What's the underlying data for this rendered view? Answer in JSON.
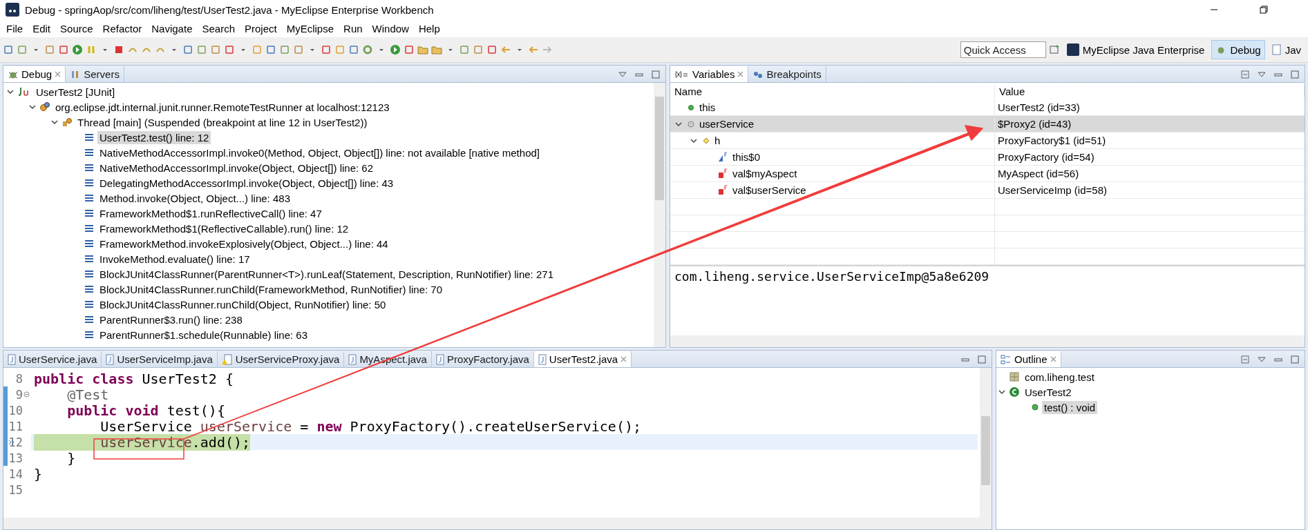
{
  "window": {
    "title": "Debug - springAop/src/com/liheng/test/UserTest2.java - MyEclipse Enterprise Workbench"
  },
  "menu": [
    "File",
    "Edit",
    "Source",
    "Refactor",
    "Navigate",
    "Search",
    "Project",
    "MyEclipse",
    "Run",
    "Window",
    "Help"
  ],
  "quick_access": {
    "placeholder": "Quick Access"
  },
  "perspectives": [
    {
      "label": "MyEclipse Java Enterprise",
      "selected": false
    },
    {
      "label": "Debug",
      "selected": true
    },
    {
      "label": "Jav",
      "selected": false
    }
  ],
  "debug": {
    "tabs": [
      {
        "label": "Debug",
        "selected": true,
        "kind": "debug"
      },
      {
        "label": "Servers",
        "selected": false,
        "kind": "servers"
      }
    ],
    "tree": [
      {
        "label": "UserTest2 [JUnit]",
        "kind": "launch",
        "expanded": true,
        "selected": false,
        "children": [
          {
            "label": "org.eclipse.jdt.internal.junit.runner.RemoteTestRunner at localhost:12123",
            "kind": "target",
            "expanded": true,
            "selected": false,
            "children": [
              {
                "label": "Thread [main] (Suspended (breakpoint at line 12 in UserTest2))",
                "kind": "thread",
                "expanded": true,
                "selected": false,
                "children": [
                  {
                    "label": "UserTest2.test() line: 12",
                    "kind": "frame",
                    "selected": true
                  },
                  {
                    "label": "NativeMethodAccessorImpl.invoke0(Method, Object, Object[]) line: not available [native method]",
                    "kind": "frame",
                    "selected": false
                  },
                  {
                    "label": "NativeMethodAccessorImpl.invoke(Object, Object[]) line: 62",
                    "kind": "frame",
                    "selected": false
                  },
                  {
                    "label": "DelegatingMethodAccessorImpl.invoke(Object, Object[]) line: 43",
                    "kind": "frame",
                    "selected": false
                  },
                  {
                    "label": "Method.invoke(Object, Object...) line: 483",
                    "kind": "frame",
                    "selected": false
                  },
                  {
                    "label": "FrameworkMethod$1.runReflectiveCall() line: 47",
                    "kind": "frame",
                    "selected": false
                  },
                  {
                    "label": "FrameworkMethod$1(ReflectiveCallable).run() line: 12",
                    "kind": "frame",
                    "selected": false
                  },
                  {
                    "label": "FrameworkMethod.invokeExplosively(Object, Object...) line: 44",
                    "kind": "frame",
                    "selected": false
                  },
                  {
                    "label": "InvokeMethod.evaluate() line: 17",
                    "kind": "frame",
                    "selected": false
                  },
                  {
                    "label": "BlockJUnit4ClassRunner(ParentRunner<T>).runLeaf(Statement, Description, RunNotifier) line: 271",
                    "kind": "frame",
                    "selected": false
                  },
                  {
                    "label": "BlockJUnit4ClassRunner.runChild(FrameworkMethod, RunNotifier) line: 70",
                    "kind": "frame",
                    "selected": false
                  },
                  {
                    "label": "BlockJUnit4ClassRunner.runChild(Object, RunNotifier) line: 50",
                    "kind": "frame",
                    "selected": false
                  },
                  {
                    "label": "ParentRunner$3.run() line: 238",
                    "kind": "frame",
                    "selected": false
                  },
                  {
                    "label": "ParentRunner$1.schedule(Runnable) line: 63",
                    "kind": "frame",
                    "selected": false
                  }
                ]
              }
            ]
          }
        ]
      }
    ]
  },
  "variables": {
    "tabs": [
      {
        "label": "Variables",
        "selected": true,
        "kind": "variables"
      },
      {
        "label": "Breakpoints",
        "selected": false,
        "kind": "breakpoints"
      }
    ],
    "columns": [
      "Name",
      "Value"
    ],
    "rows": [
      {
        "name": "this",
        "value": "UserTest2  (id=33)",
        "kind": "local",
        "selected": false
      },
      {
        "name": "userService",
        "value": "$Proxy2  (id=43)",
        "kind": "proxy",
        "selected": true,
        "expanded": true,
        "children": [
          {
            "name": "h",
            "value": "ProxyFactory$1  (id=51)",
            "kind": "field",
            "selected": false,
            "expanded": true,
            "children": [
              {
                "name": "this$0",
                "value": "ProxyFactory  (id=54)",
                "kind": "final_field",
                "selected": false
              },
              {
                "name": "val$myAspect",
                "value": "MyAspect  (id=56)",
                "kind": "private_field",
                "selected": false
              },
              {
                "name": "val$userService",
                "value": "UserServiceImp  (id=58)",
                "kind": "private_field",
                "selected": false
              }
            ]
          }
        ]
      }
    ],
    "detail": "com.liheng.service.UserServiceImp@5a8e6209"
  },
  "editor": {
    "tabs": [
      {
        "label": "UserService.java",
        "selected": false,
        "kind": "java"
      },
      {
        "label": "UserServiceImp.java",
        "selected": false,
        "kind": "java"
      },
      {
        "label": "UserServiceProxy.java",
        "selected": false,
        "kind": "java_warning"
      },
      {
        "label": "MyAspect.java",
        "selected": false,
        "kind": "java"
      },
      {
        "label": "ProxyFactory.java",
        "selected": false,
        "kind": "java"
      },
      {
        "label": "UserTest2.java",
        "selected": true,
        "kind": "java"
      }
    ],
    "lines": [
      {
        "number": "8",
        "range": false,
        "foldable": false,
        "current": false,
        "tokens": [
          {
            "text": "public class",
            "kind": "keyword"
          },
          {
            "text": " UserTest2 {",
            "kind": "plain"
          }
        ]
      },
      {
        "number": "9",
        "range": true,
        "foldable": true,
        "current": false,
        "tokens": [
          {
            "text": "    @Test",
            "kind": "annotation"
          }
        ]
      },
      {
        "number": "10",
        "range": true,
        "foldable": false,
        "current": false,
        "tokens": [
          {
            "text": "    public void",
            "kind": "keyword"
          },
          {
            "text": " test(){",
            "kind": "plain"
          }
        ]
      },
      {
        "number": "11",
        "range": true,
        "foldable": false,
        "current": false,
        "tokens": [
          {
            "text": "        UserService ",
            "kind": "plain"
          },
          {
            "text": "userService",
            "kind": "local"
          },
          {
            "text": " = ",
            "kind": "plain"
          },
          {
            "text": "new",
            "kind": "keyword"
          },
          {
            "text": " ProxyFactory().createUserService();",
            "kind": "plain"
          }
        ]
      },
      {
        "number": "12",
        "range": true,
        "foldable": false,
        "current": true,
        "tokens": [
          {
            "text": "        userService",
            "kind": "local"
          },
          {
            "text": ".add();",
            "kind": "plain"
          }
        ]
      },
      {
        "number": "13",
        "range": true,
        "foldable": false,
        "current": false,
        "tokens": [
          {
            "text": "    }",
            "kind": "plain"
          }
        ]
      },
      {
        "number": "14",
        "range": false,
        "foldable": false,
        "current": false,
        "tokens": [
          {
            "text": "}",
            "kind": "plain"
          }
        ]
      },
      {
        "number": "15",
        "range": false,
        "foldable": false,
        "current": false
      }
    ]
  },
  "outline": {
    "tabs": [
      {
        "label": "Outline",
        "selected": true,
        "kind": "outline"
      }
    ],
    "tree": [
      {
        "label": "com.liheng.test",
        "kind": "package",
        "selected": false
      },
      {
        "label": "UserTest2",
        "kind": "class",
        "selected": false,
        "expanded": true,
        "children": [
          {
            "label": "test() : void",
            "kind": "method",
            "selected": true
          }
        ]
      }
    ]
  }
}
